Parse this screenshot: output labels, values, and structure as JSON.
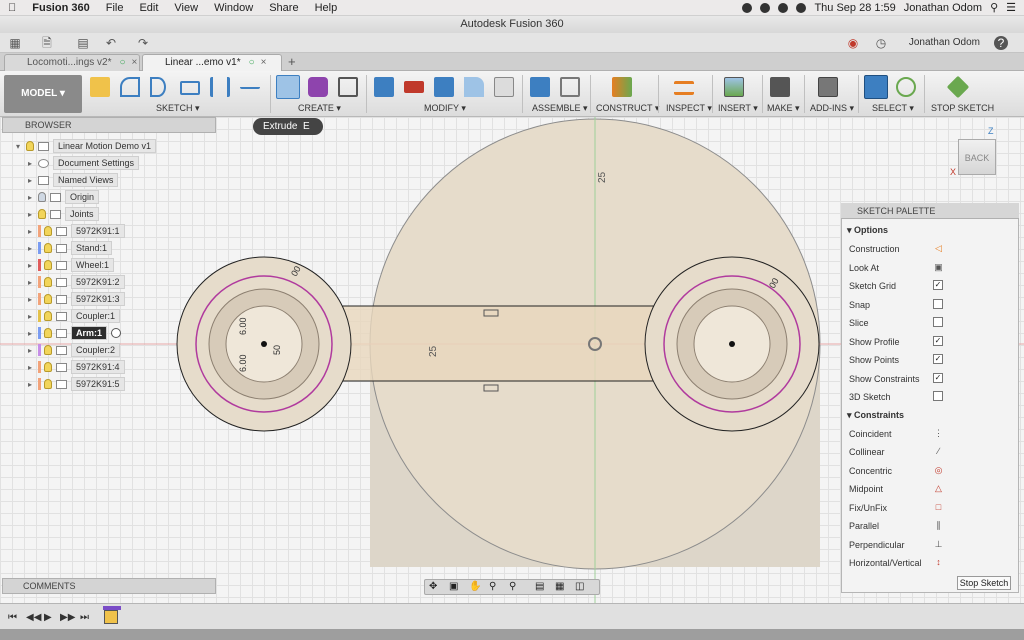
{
  "menubar": {
    "app": "Fusion 360",
    "items": [
      "File",
      "Edit",
      "View",
      "Window",
      "Share",
      "Help"
    ],
    "clock": "Thu Sep 28  1:59",
    "user": "Jonathan Odom"
  },
  "window": {
    "title": "Autodesk Fusion 360"
  },
  "apptoolbar": {
    "user": "Jonathan Odom",
    "help": "?"
  },
  "tabs": [
    {
      "label": "Locomoti...ings v2*"
    },
    {
      "label": "Linear ...emo v1*"
    }
  ],
  "ribbon": {
    "workspace": "MODEL",
    "groups": [
      "SKETCH",
      "CREATE",
      "MODIFY",
      "ASSEMBLE",
      "CONSTRUCT",
      "INSPECT",
      "INSERT",
      "MAKE",
      "ADD-INS",
      "SELECT",
      "STOP SKETCH"
    ]
  },
  "tooltip": {
    "text": "Extrude",
    "shortcut": "E"
  },
  "browser": {
    "title": "BROWSER",
    "root": "Linear Motion Demo v1",
    "items": [
      "Document Settings",
      "Named Views",
      "Origin",
      "Joints",
      "5972K91:1",
      "Stand:1",
      "Wheel:1",
      "5972K91:2",
      "5972K91:3",
      "Coupler:1",
      "Arm:1",
      "Coupler:2",
      "5972K91:4",
      "5972K91:5"
    ]
  },
  "viewcube": {
    "label": "BACK",
    "axis_z": "Z",
    "axis_x": "X"
  },
  "sketch": {
    "dims": {
      "d25_top": "25",
      "d25_left": "25",
      "d600a": "6.00",
      "d600b": "6.00",
      "d50": "50",
      "r00_left": "00",
      "r00_right": "00"
    }
  },
  "palette": {
    "title": "SKETCH PALETTE",
    "options_title": "Options",
    "options": [
      {
        "label": "Construction",
        "checked": null
      },
      {
        "label": "Look At",
        "checked": null
      },
      {
        "label": "Sketch Grid",
        "checked": true
      },
      {
        "label": "Snap",
        "checked": false
      },
      {
        "label": "Slice",
        "checked": false
      },
      {
        "label": "Show Profile",
        "checked": true
      },
      {
        "label": "Show Points",
        "checked": true
      },
      {
        "label": "Show Constraints",
        "checked": true
      },
      {
        "label": "3D Sketch",
        "checked": false
      }
    ],
    "constraints_title": "Constraints",
    "constraints": [
      "Coincident",
      "Collinear",
      "Concentric",
      "Midpoint",
      "Fix/UnFix",
      "Parallel",
      "Perpendicular",
      "Horizontal/Vertical"
    ],
    "stop_label": "Stop Sketch"
  },
  "comments": {
    "title": "COMMENTS"
  },
  "colors": {
    "accent_green": "#3aa655",
    "selection_blue": "#3d7fc1",
    "profile_fill": "#e7dccb"
  }
}
